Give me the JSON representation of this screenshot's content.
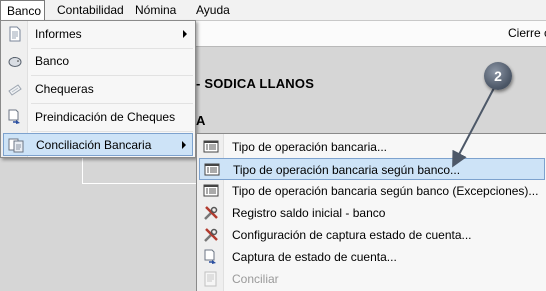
{
  "menubar": {
    "items": [
      "Banco",
      "Contabilidad",
      "Nómina",
      "Ayuda"
    ]
  },
  "toolbar": {
    "cierre_label": "Cierre c"
  },
  "content": {
    "org_title": "- SODICA LLANOS",
    "section_title": "A"
  },
  "banco_menu": {
    "items": [
      {
        "label": "Informes",
        "icon": "document-icon",
        "submenu": true
      },
      {
        "label": "Banco",
        "icon": "piggy-bank-icon",
        "submenu": false
      },
      {
        "label": "Chequeras",
        "icon": "checkbook-icon",
        "submenu": false
      },
      {
        "label": "Preindicación de Cheques",
        "icon": "document-arrow-icon",
        "submenu": false
      },
      {
        "label": "Conciliación Bancaria",
        "icon": "reconcile-icon",
        "submenu": true
      }
    ]
  },
  "conciliacion_submenu": {
    "items": [
      {
        "label": "Tipo de operación bancaria...",
        "icon": "list-window-icon",
        "enabled": true
      },
      {
        "label": "Tipo de operación bancaria según banco...",
        "icon": "list-window-icon",
        "enabled": true
      },
      {
        "label": "Tipo de operación bancaria según banco (Excepciones)...",
        "icon": "list-window-icon",
        "enabled": true
      },
      {
        "label": "Registro saldo inicial - banco",
        "icon": "tools-icon",
        "enabled": true
      },
      {
        "label": "Configuración de captura estado de cuenta...",
        "icon": "tools-icon",
        "enabled": true
      },
      {
        "label": "Captura de estado de cuenta...",
        "icon": "document-arrow-icon",
        "enabled": true
      },
      {
        "label": "Conciliar",
        "icon": "reconcile-icon",
        "enabled": false
      }
    ]
  },
  "callout": {
    "number": "2"
  },
  "colors": {
    "selection": "#cde3f7",
    "selection_border": "#7da2ce",
    "callout": "#4d5868"
  }
}
